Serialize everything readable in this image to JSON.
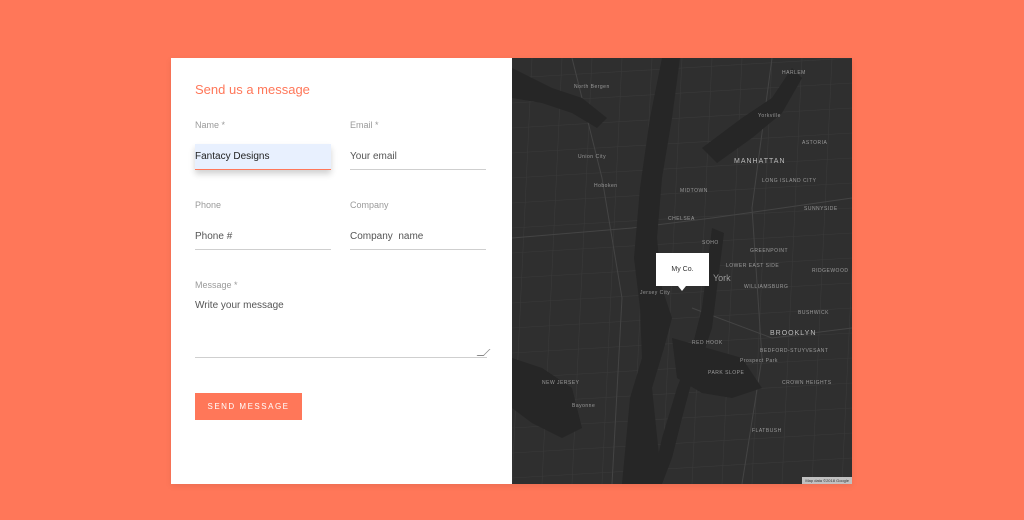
{
  "form": {
    "title": "Send us a message",
    "name": {
      "label": "Name *",
      "value": "Fantacy Designs"
    },
    "email": {
      "label": "Email *",
      "placeholder": "Your email"
    },
    "phone": {
      "label": "Phone",
      "placeholder": "Phone #"
    },
    "company": {
      "label": "Company",
      "placeholder": "Company  name"
    },
    "message": {
      "label": "Message *",
      "placeholder": "Write your message"
    },
    "send_label": "SEND MESSAGE"
  },
  "map": {
    "marker_label": "My Co.",
    "labels": {
      "manhattan": "MANHATTAN",
      "york": "York",
      "brooklyn": "BROOKLYN",
      "new_jersey": "NEW JERSEY",
      "north_bergen": "North Bergen",
      "union_city": "Union City",
      "hoboken": "Hoboken",
      "jersey_city": "Jersey City",
      "harlem": "HARLEM",
      "yorkville": "Yorkville",
      "long_island_city": "LONG ISLAND CITY",
      "greenpoint": "GREENPOINT",
      "williamsburg": "WILLIAMSBURG",
      "bushwick": "BUSHWICK",
      "bedstuy": "BEDFORD-STUYVESANT",
      "crown_heights": "CROWN HEIGHTS",
      "park_slope": "PARK SLOPE",
      "red_hook": "RED HOOK",
      "bayonne": "Bayonne",
      "flatbush": "FLATBUSH",
      "midtown": "MIDTOWN",
      "chelsea": "CHELSEA",
      "soho": "SOHO",
      "les": "LOWER EAST SIDE",
      "astoria": "ASTORIA",
      "sunnyside": "SUNNYSIDE",
      "ridgewood": "RIDGEWOOD",
      "prospect_park": "Prospect Park"
    },
    "attribution": "Map data ©2018 Google"
  },
  "colors": {
    "accent": "#ff7759",
    "map_bg": "#2f2f2f",
    "water": "#262626"
  }
}
